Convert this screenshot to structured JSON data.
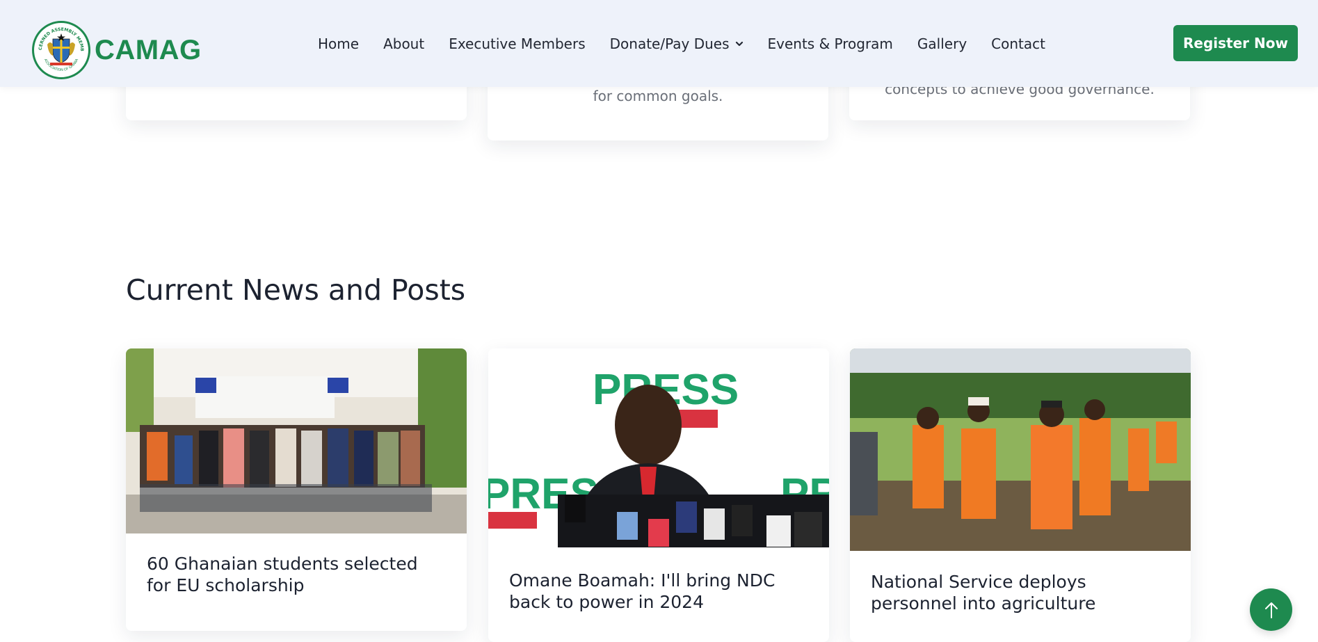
{
  "brand": {
    "name": "CAMAG",
    "emblem_text_top": "CONCERNED ASSEMBLY MEMBERS",
    "emblem_text_bottom": "ASSOCIATION OF GHANA",
    "color": "#1e8a4f"
  },
  "nav": {
    "items": [
      {
        "label": "Home"
      },
      {
        "label": "About"
      },
      {
        "label": "Executive Members"
      },
      {
        "label": "Donate/Pay Dues",
        "has_dropdown": true
      },
      {
        "label": "Events & Program"
      },
      {
        "label": "Gallery"
      },
      {
        "label": "Contact"
      }
    ],
    "cta": "Register Now"
  },
  "value_cards": [
    {
      "text": ""
    },
    {
      "text": "for common goals."
    },
    {
      "text": "concepts to achieve good governance."
    }
  ],
  "news": {
    "heading": "Current News and Posts",
    "posts": [
      {
        "title": "60 Ghanaian students selected for EU scholarship",
        "image": "group-photo"
      },
      {
        "title": "Omane Boamah: I'll bring NDC back to power in 2024",
        "image": "press-briefing-photo"
      },
      {
        "title": "National Service deploys personnel into agriculture",
        "image": "farm-field-photo"
      }
    ]
  },
  "scroll_top": {
    "icon": "arrow-up-icon"
  }
}
